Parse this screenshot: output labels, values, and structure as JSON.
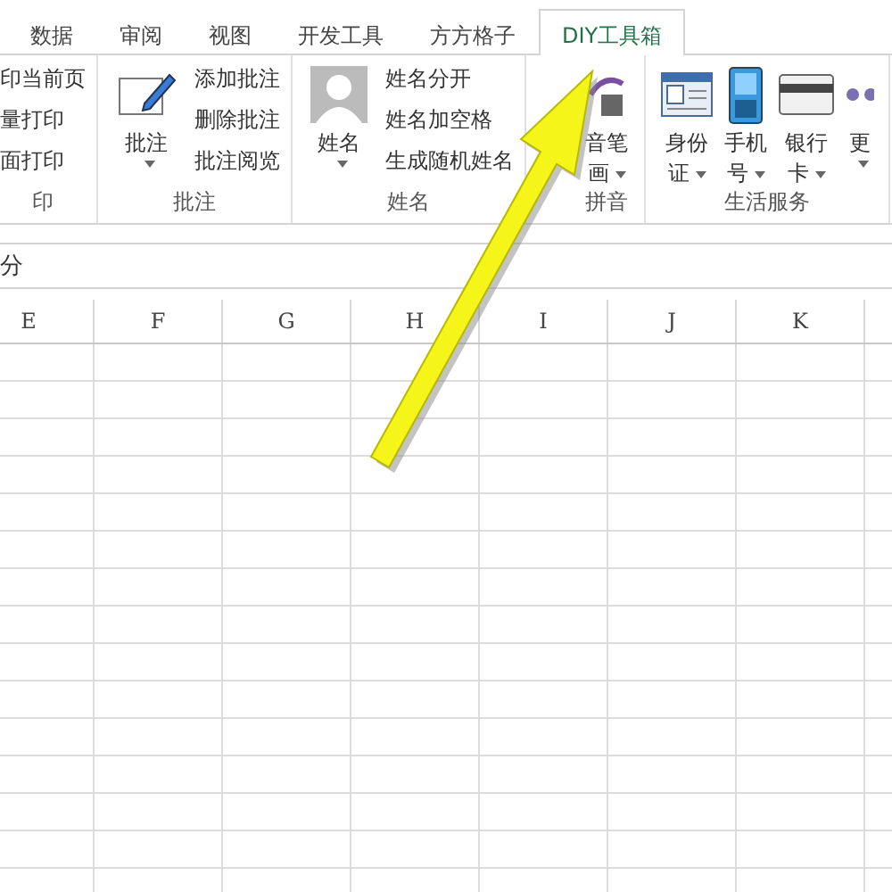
{
  "tabs": [
    {
      "label": "数据",
      "selected": false
    },
    {
      "label": "审阅",
      "selected": false
    },
    {
      "label": "视图",
      "selected": false
    },
    {
      "label": "开发工具",
      "selected": false
    },
    {
      "label": "方方格子",
      "selected": false
    },
    {
      "label": "DIY工具箱",
      "selected": true
    }
  ],
  "groups": [
    {
      "label": "印",
      "small": [
        "印当前页",
        "量打印",
        "面打印"
      ]
    },
    {
      "label": "批注",
      "large": [
        {
          "kind": "note",
          "lines": [
            "批注"
          ]
        }
      ],
      "small": [
        "添加批注",
        "删除批注",
        "批注阅览"
      ]
    },
    {
      "label": "姓名",
      "large": [
        {
          "kind": "person",
          "lines": [
            "姓名"
          ]
        }
      ],
      "small": [
        "姓名分开",
        "姓名加空格",
        "生成随机姓名"
      ]
    },
    {
      "label": "拼音",
      "large": [
        {
          "kind": "pinyin",
          "lines": [
            "音笔",
            "画"
          ]
        }
      ]
    },
    {
      "label": "生活服务",
      "large": [
        {
          "kind": "card",
          "lines": [
            "身份",
            "证"
          ]
        },
        {
          "kind": "phone",
          "lines": [
            "手机",
            "号"
          ]
        },
        {
          "kind": "bank",
          "lines": [
            "银行",
            "卡"
          ]
        },
        {
          "kind": "more",
          "lines": [
            "更"
          ]
        }
      ]
    }
  ],
  "formula_bar": {
    "text": "分"
  },
  "columns": [
    "E",
    "F",
    "G",
    "H",
    "I",
    "J",
    "K"
  ]
}
